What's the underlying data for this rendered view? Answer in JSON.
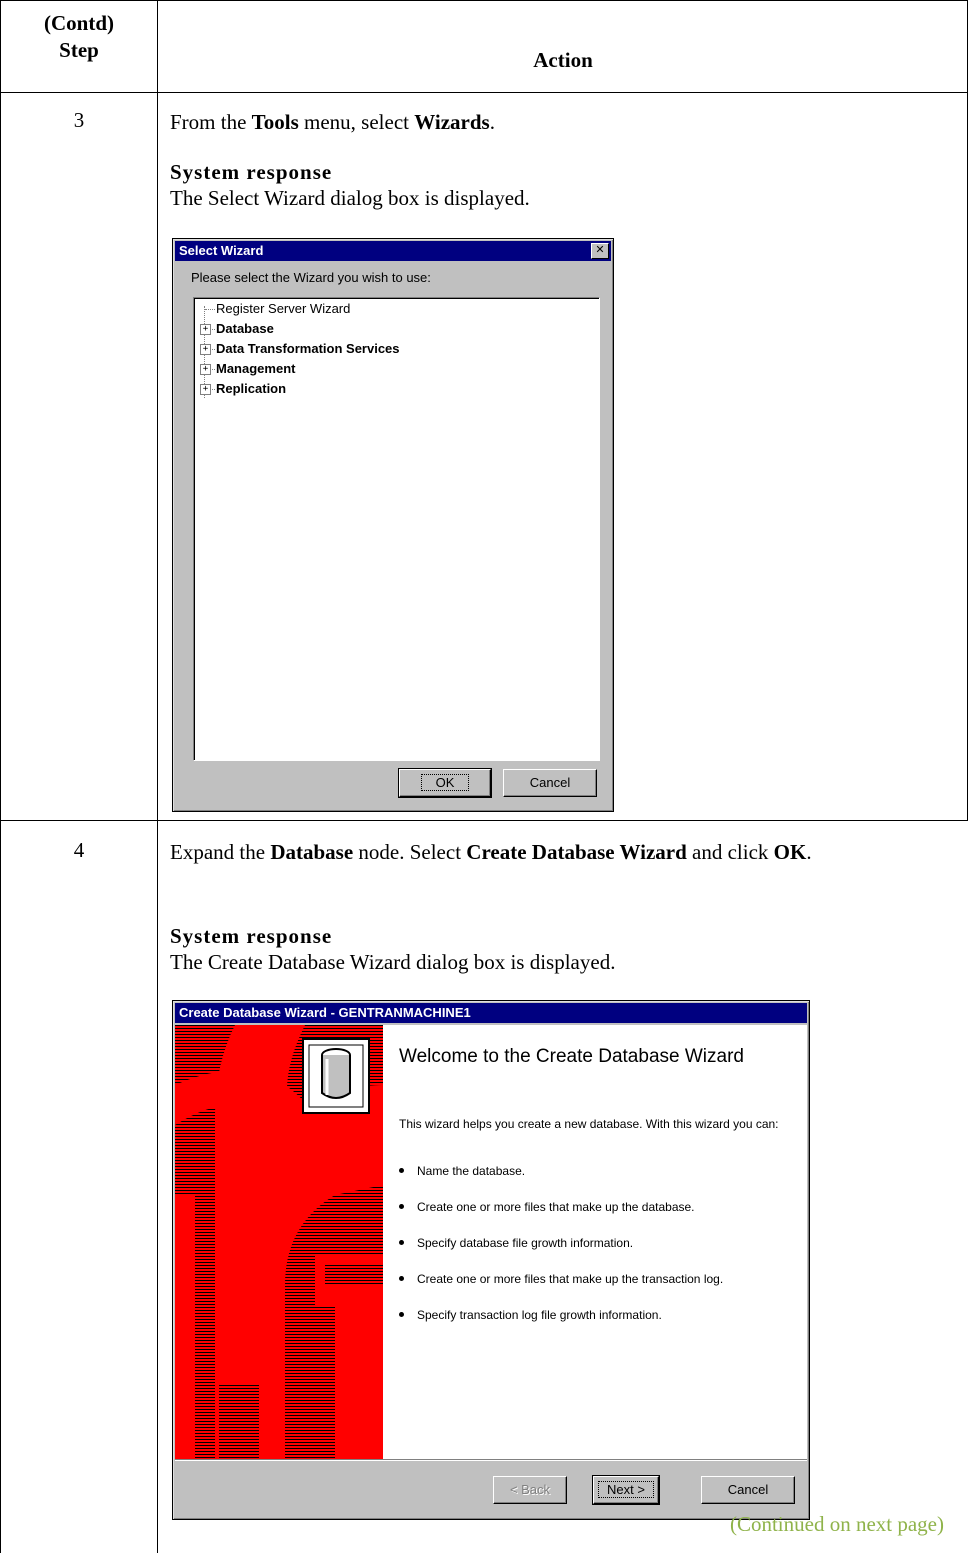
{
  "header": {
    "step_line1": "(Contd)",
    "step_line2": "Step",
    "action": "Action"
  },
  "steps": [
    {
      "number": "3",
      "instruction": {
        "pre": "From the ",
        "menu": "Tools",
        "mid": " menu, select ",
        "item": "Wizards",
        "post": "."
      },
      "response_heading": "System response",
      "response_text": "The Select Wizard dialog box is displayed.",
      "dialog": {
        "title": "Select Wizard",
        "prompt": "Please select the Wizard you wish to use:",
        "tree": [
          {
            "label": "Register Server Wizard",
            "expandable": false
          },
          {
            "label": "Database",
            "expandable": true
          },
          {
            "label": "Data Transformation Services",
            "expandable": true
          },
          {
            "label": "Management",
            "expandable": true
          },
          {
            "label": "Replication",
            "expandable": true
          }
        ],
        "ok_label": "OK",
        "cancel_label": "Cancel"
      }
    },
    {
      "number": "4",
      "instruction": {
        "pre": "Expand the ",
        "node": "Database",
        "mid": " node. Select ",
        "wizard": "Create Database Wizard",
        "mid2": " and click ",
        "ok": "OK",
        "post": "."
      },
      "response_heading": "System response",
      "response_text": "The Create Database Wizard dialog box is displayed.",
      "dialog": {
        "title": "Create Database Wizard - GENTRANMACHINE1",
        "heading": "Welcome to the Create Database Wizard",
        "intro": "This wizard helps you create a new database.  With this wizard you can:",
        "bullets": [
          "Name the database.",
          "Create one or more files that make up the database.",
          "Specify database file growth information.",
          "Create one or more files that make up the transaction log.",
          "Specify transaction log file growth information."
        ],
        "back_label": "< Back",
        "next_label": "Next >",
        "cancel_label": "Cancel"
      }
    }
  ],
  "footer": {
    "continued": "(Continued on next page)"
  },
  "colors": {
    "titlebar": "#000080",
    "dialog_face": "#c0c0c0",
    "wizard_art": "#ff0000",
    "continued_text": "#8fb34a"
  }
}
